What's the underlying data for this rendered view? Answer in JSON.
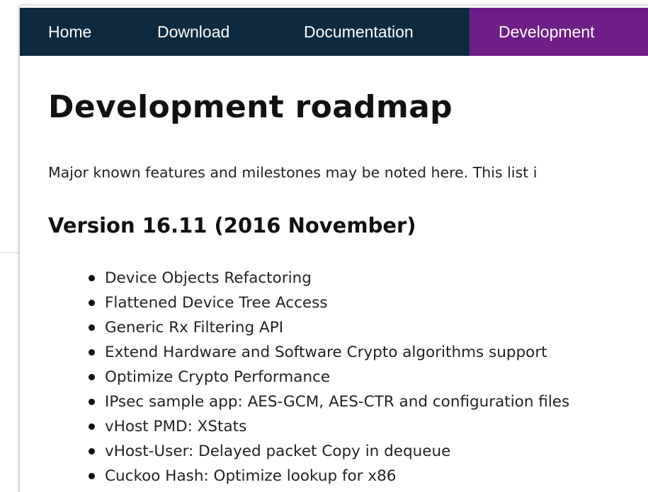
{
  "nav": {
    "items": [
      {
        "label": "Home"
      },
      {
        "label": "Download"
      },
      {
        "label": "Documentation"
      },
      {
        "label": "Development"
      }
    ],
    "active_color": "#6f1e87",
    "bar_color": "#0d2a40"
  },
  "page": {
    "title": "Development roadmap",
    "intro": "Major known features and milestones may be noted here. This list i"
  },
  "section": {
    "heading": "Version 16.11 (2016 November)",
    "features": [
      "Device Objects Refactoring",
      "Flattened Device Tree Access",
      "Generic Rx Filtering API",
      "Extend Hardware and Software Crypto algorithms support",
      "Optimize Crypto Performance",
      "IPsec sample app: AES-GCM, AES-CTR and configuration files",
      "vHost PMD: XStats",
      "vHost-User: Delayed packet Copy in dequeue",
      "Cuckoo Hash: Optimize lookup for x86"
    ]
  }
}
